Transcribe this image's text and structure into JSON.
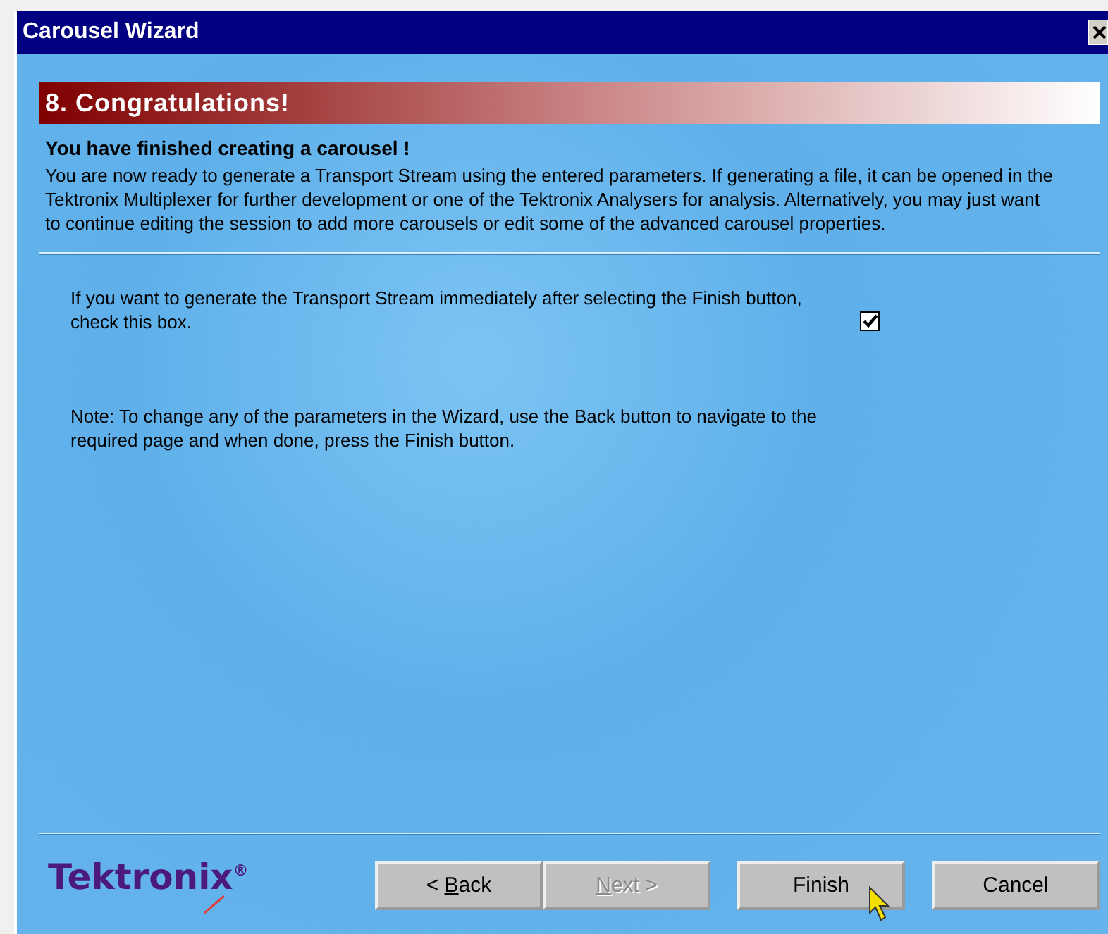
{
  "window": {
    "title": "Carousel Wizard"
  },
  "step": {
    "title": "8. Congratulations!"
  },
  "heading": "You have finished creating a carousel !",
  "intro": "You are now ready to generate a Transport Stream using the entered parameters. If generating a file, it can be opened in the Tektronix Multiplexer for further development or one of the Tektronix Analysers for analysis. Alternatively, you may just want to continue editing the session to add more carousels or edit some of the advanced carousel properties.",
  "generate_option": {
    "label": "If you want to generate the Transport Stream immediately after selecting the Finish button, check this box.",
    "checked": true
  },
  "note": "Note: To change any of the parameters in the Wizard, use the Back button to navigate to the required page and when done, press the Finish button.",
  "logo": "Tektronix$^{®}$",
  "nav_buttons": [
    {
      "prefix": "< ",
      "mnemonic": "B",
      "rest": "ack",
      "disabled": false
    },
    {
      "mnemonic": "N",
      "rest": "ext >",
      "disabled": true
    }
  ],
  "action_buttons": [
    {
      "rest": "Finish",
      "disabled": false
    },
    {
      "rest": "Cancel",
      "disabled": false
    }
  ]
}
